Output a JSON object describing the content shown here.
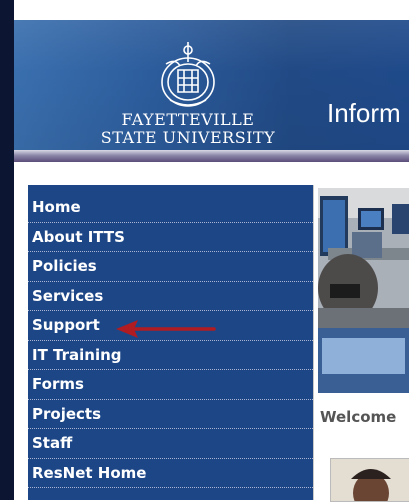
{
  "header": {
    "title": "Inform",
    "logo_line1": "Fayetteville",
    "logo_line2": "State University"
  },
  "sidebar": {
    "items": [
      {
        "label": "Home"
      },
      {
        "label": "About ITTS"
      },
      {
        "label": "Policies"
      },
      {
        "label": "Services"
      },
      {
        "label": "Support"
      },
      {
        "label": "IT Training"
      },
      {
        "label": "Forms"
      },
      {
        "label": "Projects"
      },
      {
        "label": "Staff"
      },
      {
        "label": "ResNet Home"
      }
    ]
  },
  "main": {
    "welcome_heading": "Welcome"
  },
  "colors": {
    "nav_bg": "#1d4687",
    "header_blue": "#2c5c9c",
    "arrow_red": "#b01c22"
  },
  "icons": {
    "annotation_arrow": "left-arrow-icon"
  }
}
